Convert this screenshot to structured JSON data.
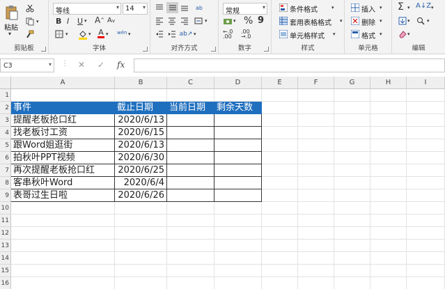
{
  "ribbon": {
    "clipboard": {
      "paste_label": "粘贴",
      "group_label": "剪贴板"
    },
    "font": {
      "font_name": "等线",
      "font_size": "14",
      "bold": "B",
      "italic": "I",
      "underline": "U",
      "grow": "A",
      "shrink": "A",
      "color_a": "A",
      "phonetic": "wén",
      "group_label": "字体"
    },
    "alignment": {
      "group_label": "对齐方式"
    },
    "number": {
      "format": "常规",
      "percent": "%",
      "comma": "9",
      "group_label": "数字"
    },
    "styles": {
      "conditional": "条件格式",
      "table": "套用表格格式",
      "cell": "单元格样式",
      "group_label": "样式"
    },
    "cells": {
      "insert": "插入",
      "delete": "删除",
      "format": "格式",
      "group_label": "单元格"
    },
    "editing": {
      "sigma": "Σ",
      "group_label": "编辑"
    }
  },
  "formula_bar": {
    "name_box": "C3",
    "cancel": "✕",
    "enter": "✓",
    "fx": "fx",
    "value": ""
  },
  "columns": [
    "A",
    "B",
    "C",
    "D",
    "E",
    "F",
    "G",
    "H",
    "I"
  ],
  "rows": [
    "1",
    "2",
    "3",
    "4",
    "5",
    "6",
    "7",
    "8",
    "9",
    "10",
    "11",
    "12",
    "13",
    "14",
    "15",
    "16"
  ],
  "table": {
    "headers": [
      "事件",
      "截止日期",
      "当前日期",
      "剩余天数"
    ],
    "rows": [
      [
        "提醒老板抢口红",
        "2020/6/13"
      ],
      [
        "找老板讨工资",
        "2020/6/15"
      ],
      [
        "跟Word姐逛街",
        "2020/6/13"
      ],
      [
        "拍秋叶PPT视频",
        "2020/6/30"
      ],
      [
        "再次提醒老板抢口红",
        "2020/6/25"
      ],
      [
        "客串秋叶Word",
        "2020/6/4"
      ],
      [
        "表哥过生日啦",
        "2020/6/26"
      ]
    ]
  },
  "colors": {
    "header_fill": "#1f6fbf",
    "ribbon_bg": "#f3f3f3"
  }
}
